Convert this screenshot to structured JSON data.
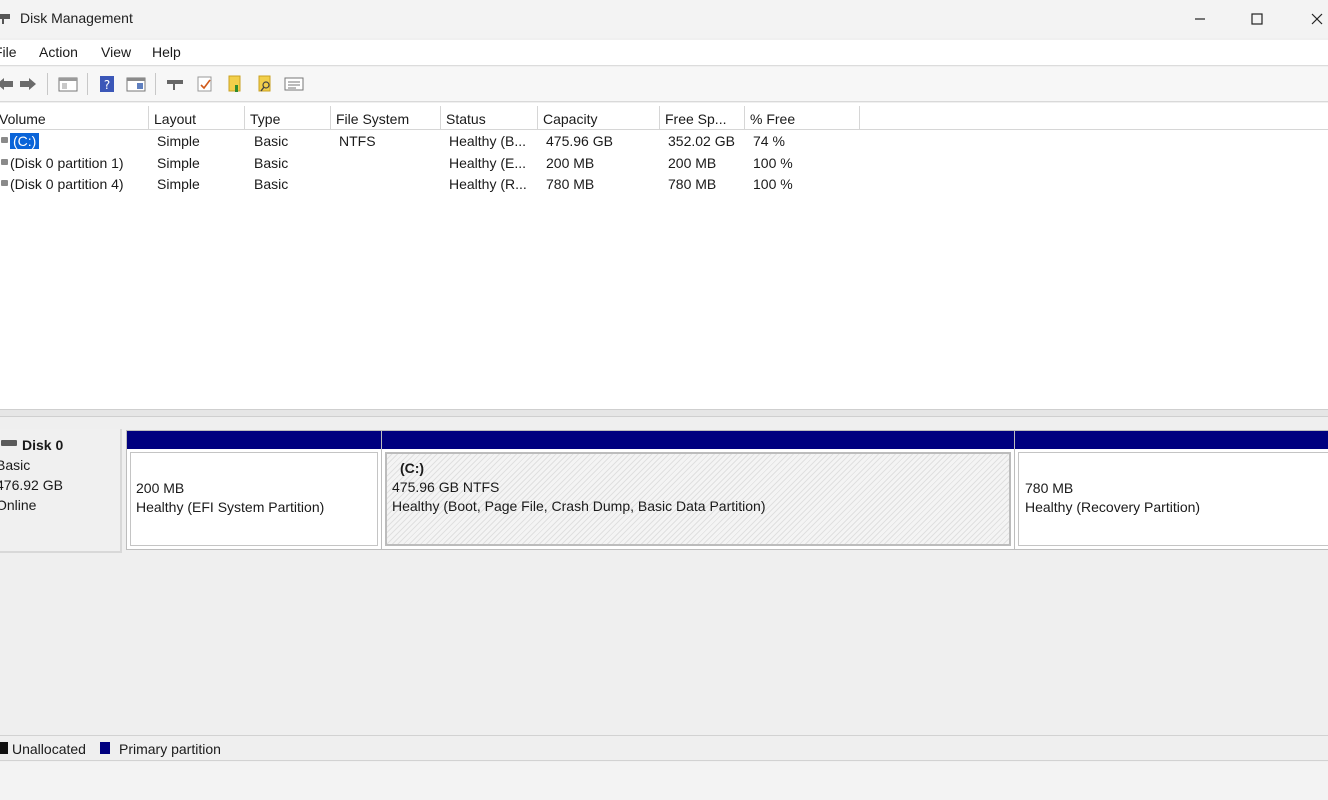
{
  "window": {
    "title": "Disk Management",
    "minimize": "—",
    "maximize": "☐",
    "close": "✕"
  },
  "menu": [
    "File",
    "Action",
    "View",
    "Help"
  ],
  "toolbar": {
    "icons": [
      "back-arrow-icon",
      "forward-arrow-icon",
      "console-tree-icon",
      "help-icon",
      "properties-icon",
      "connect-icon",
      "check-icon",
      "folder-icon",
      "search-folder-icon",
      "list-icon"
    ]
  },
  "columns": [
    "Volume",
    "Layout",
    "Type",
    "File System",
    "Status",
    "Capacity",
    "Free Sp...",
    "% Free"
  ],
  "volumes": [
    {
      "volume": "(C:)",
      "layout": "Simple",
      "type": "Basic",
      "filesystem": "NTFS",
      "status": "Healthy (B...",
      "capacity": "475.96 GB",
      "free": "352.02 GB",
      "pct_free": "74 %",
      "selected": true
    },
    {
      "volume": "(Disk 0 partition 1)",
      "layout": "Simple",
      "type": "Basic",
      "filesystem": "",
      "status": "Healthy (E...",
      "capacity": "200 MB",
      "free": "200 MB",
      "pct_free": "100 %",
      "selected": false
    },
    {
      "volume": "(Disk 0 partition 4)",
      "layout": "Simple",
      "type": "Basic",
      "filesystem": "",
      "status": "Healthy (R...",
      "capacity": "780 MB",
      "free": "780 MB",
      "pct_free": "100 %",
      "selected": false
    }
  ],
  "disk": {
    "name": "Disk 0",
    "type": "Basic",
    "size": "476.92 GB",
    "state": "Online",
    "partitions": [
      {
        "label": "",
        "size": "200 MB",
        "status": "Healthy (EFI System Partition)"
      },
      {
        "label": "(C:)",
        "size": "475.96 GB NTFS",
        "status": "Healthy (Boot, Page File, Crash Dump, Basic Data Partition)"
      },
      {
        "label": "",
        "size": "780 MB",
        "status": "Healthy (Recovery Partition)"
      }
    ]
  },
  "legend": [
    {
      "label": "Unallocated",
      "color": "#111111"
    },
    {
      "label": "Primary partition",
      "color": "#00007f"
    }
  ]
}
